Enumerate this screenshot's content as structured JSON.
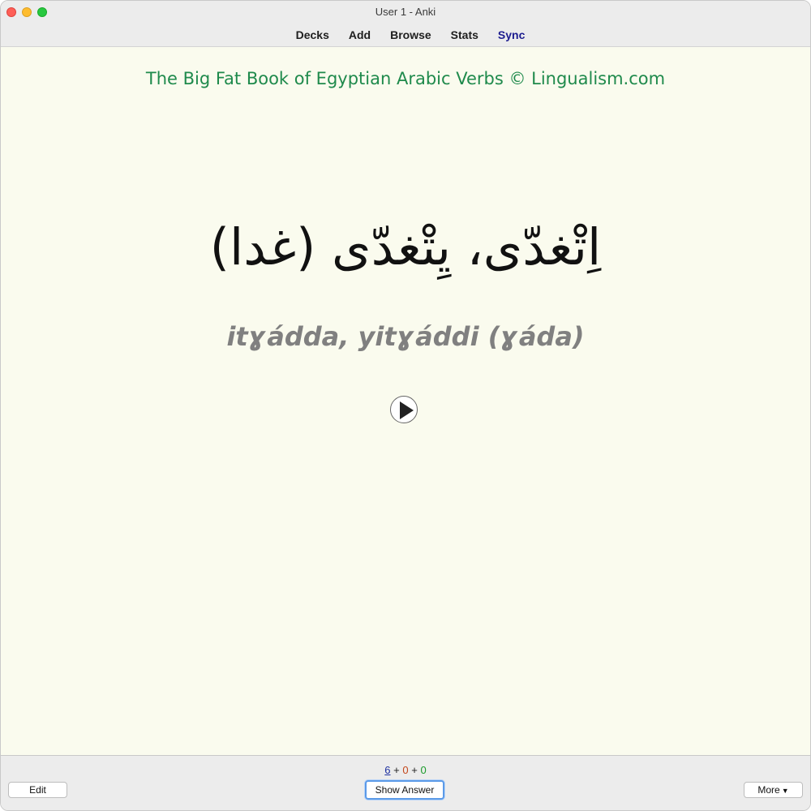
{
  "window": {
    "title": "User 1 - Anki"
  },
  "toolbar": {
    "items": [
      {
        "label": "Decks"
      },
      {
        "label": "Add"
      },
      {
        "label": "Browse"
      },
      {
        "label": "Stats"
      },
      {
        "label": "Sync"
      }
    ]
  },
  "card": {
    "deck_title": "The Big Fat Book of Egyptian Arabic Verbs © Lingualism.com",
    "arabic": "اِتْغدّى، يِتْغدّى (غدا)",
    "transliteration": "itɣádda, yitɣáddi (ɣáda)",
    "audio_icon": "play-icon"
  },
  "bottom": {
    "counts": {
      "new": "6",
      "learning": "0",
      "review": "0",
      "separator": "+"
    },
    "edit_label": "Edit",
    "show_answer_label": "Show Answer",
    "more_label": "More",
    "more_icon": "caret-down-icon"
  },
  "colors": {
    "background": "#fafbee",
    "deck_title": "#1f8a4c",
    "transliteration": "#808080",
    "count_new": "#1c2fa0",
    "count_learning": "#c3461a",
    "count_review": "#1a9a2b",
    "sync": "#1c1c8f",
    "focus_ring": "#5b9ae8"
  }
}
